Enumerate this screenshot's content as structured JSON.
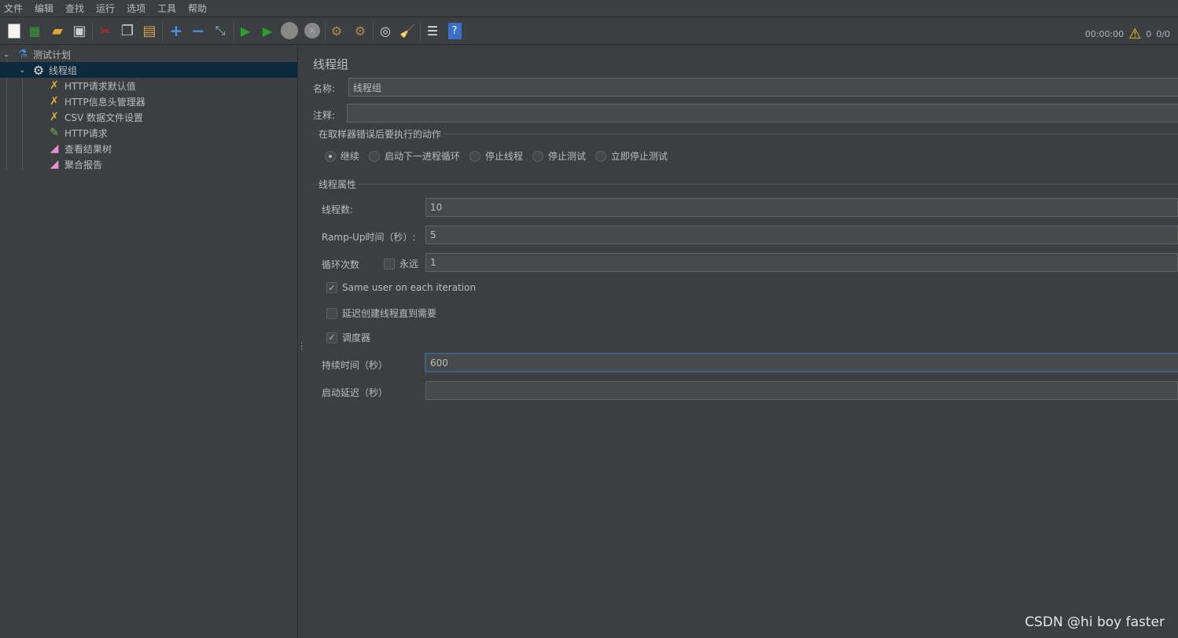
{
  "menu": [
    "文件",
    "编辑",
    "查找",
    "运行",
    "选项",
    "工具",
    "帮助"
  ],
  "toolbar": [
    {
      "icon": "new-icon"
    },
    {
      "icon": "templates-icon"
    },
    {
      "icon": "open-icon"
    },
    {
      "icon": "save-icon"
    },
    {
      "icon": "cut-icon"
    },
    {
      "icon": "copy-icon"
    },
    {
      "icon": "paste-icon"
    },
    {
      "icon": "expand-icon"
    },
    {
      "icon": "collapse-icon"
    },
    {
      "icon": "toggle-icon"
    },
    {
      "icon": "start-icon"
    },
    {
      "icon": "start-no-pause-icon"
    },
    {
      "icon": "stop-icon"
    },
    {
      "icon": "shutdown-icon"
    },
    {
      "icon": "clear-icon"
    },
    {
      "icon": "clear-all-icon"
    },
    {
      "icon": "search-icon"
    },
    {
      "icon": "reset-search-icon"
    },
    {
      "icon": "function-helper-icon"
    },
    {
      "icon": "help-icon"
    }
  ],
  "status": {
    "timer": "00:00:00",
    "warnings": "0",
    "threads": "0/0"
  },
  "tree": [
    {
      "label": "测试计划",
      "icon": "test-plan-icon",
      "level": 0
    },
    {
      "label": "线程组",
      "icon": "thread-group-icon",
      "level": 1,
      "selected": true
    },
    {
      "label": "HTTP请求默认值",
      "icon": "config-element-icon",
      "level": 2
    },
    {
      "label": "HTTP信息头管理器",
      "icon": "config-element-icon",
      "level": 2
    },
    {
      "label": "CSV 数据文件设置",
      "icon": "config-element-icon",
      "level": 2
    },
    {
      "label": "HTTP请求",
      "icon": "sampler-icon",
      "level": 2
    },
    {
      "label": "查看结果树",
      "icon": "listener-icon",
      "level": 2
    },
    {
      "label": "聚合报告",
      "icon": "listener-icon",
      "level": 2
    }
  ],
  "panel": {
    "title": "线程组",
    "name_label": "名称:",
    "name_value": "线程组",
    "comment_label": "注释:",
    "comment_value": "",
    "error_group": "在取样器错误后要执行的动作",
    "error_options": [
      "继续",
      "启动下一进程循环",
      "停止线程",
      "停止测试",
      "立即停止测试"
    ],
    "error_selected": "继续",
    "props_group": "线程属性",
    "threads_label": "线程数:",
    "threads_value": "10",
    "rampup_label": "Ramp-Up时间（秒）:",
    "rampup_value": "5",
    "loop_label": "循环次数",
    "forever_label": "永远",
    "forever_checked": false,
    "loop_value": "1",
    "same_user_label": "Same user on each iteration",
    "same_user_checked": true,
    "delay_label": "延迟创建线程直到需要",
    "delay_checked": false,
    "scheduler_label": "调度器",
    "scheduler_checked": true,
    "duration_label": "持续时间（秒）",
    "duration_value": "600",
    "startup_label": "启动延迟（秒）",
    "startup_value": ""
  },
  "watermark": "CSDN @hi boy faster"
}
